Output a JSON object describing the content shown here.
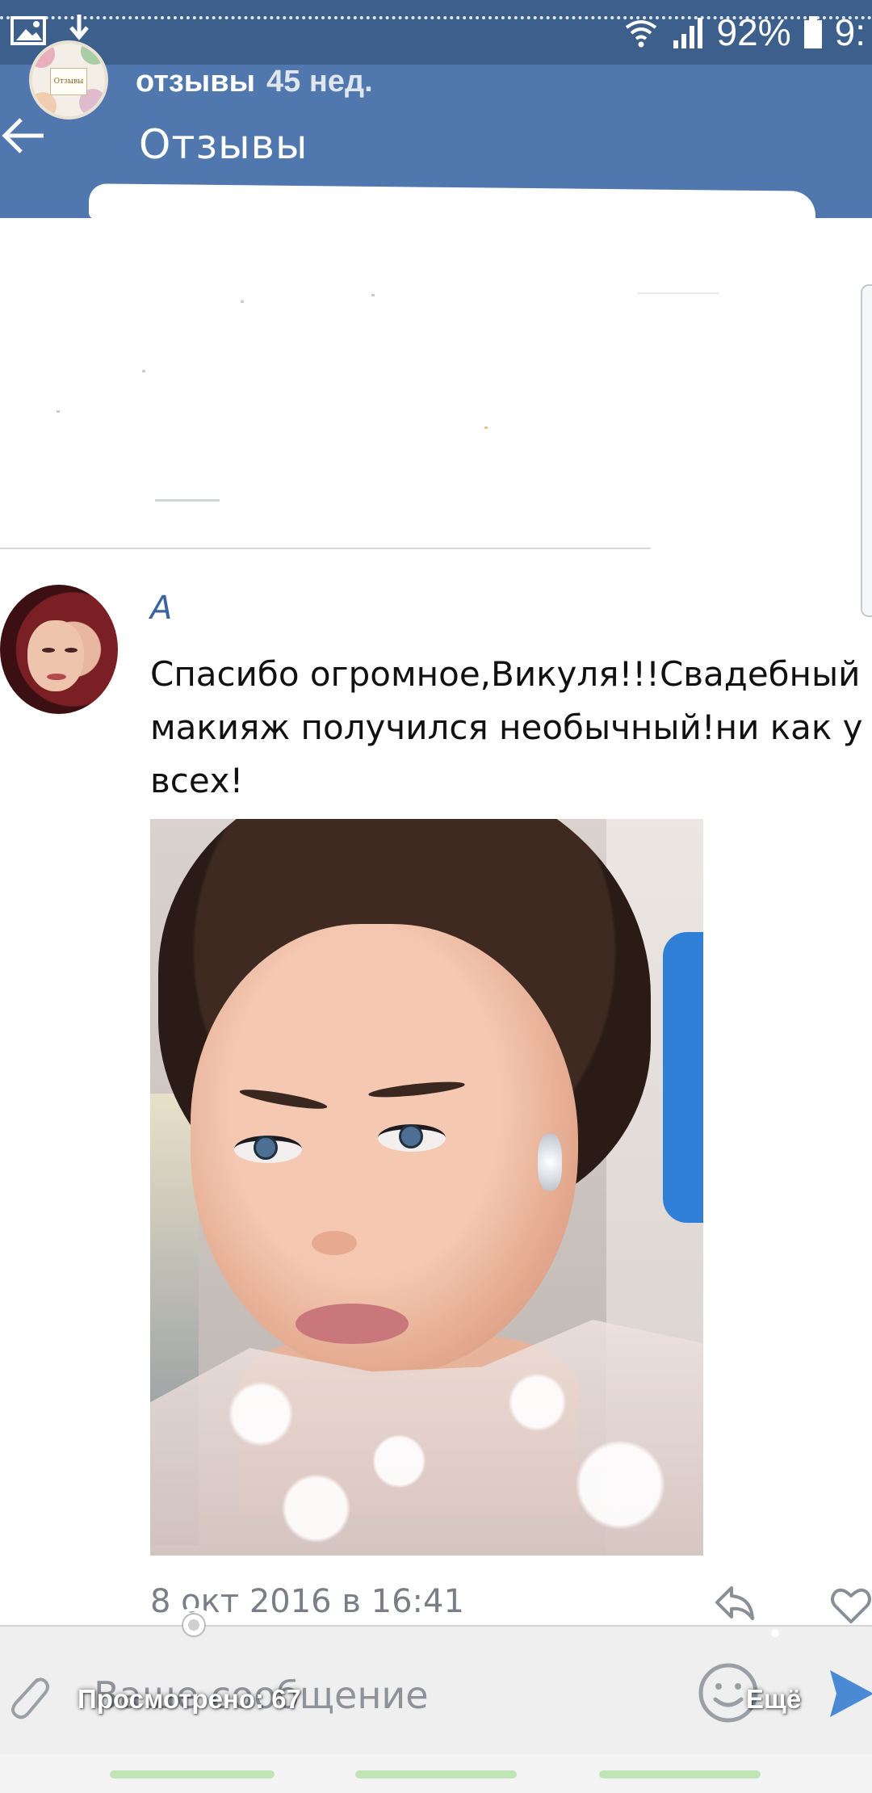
{
  "status_bar": {
    "battery": "92%",
    "clock": "9:"
  },
  "story": {
    "title": "отзывы",
    "age": "45 нед.",
    "avatar_text": "Отзывы"
  },
  "header": {
    "page_title": "Отзывы"
  },
  "comment": {
    "author_fragment": "А",
    "text": "Спасибо огромное,Викуля!!!Свадебный макияж получился необычный!ни как у всех!",
    "date": "8 окт 2016 в 16:41"
  },
  "composer": {
    "placeholder": "Ваше сообщение"
  },
  "overlay": {
    "views": "Просмотрено: 67",
    "more": "Ещё"
  },
  "colors": {
    "status_bar": "#3d5f8c",
    "header": "#5077ae",
    "link": "#3a64a0",
    "progress": "#bfe5b4"
  },
  "icons": [
    "image-icon",
    "download-icon",
    "wifi-icon",
    "signal-icon",
    "battery-icon",
    "back-arrow-icon",
    "reply-icon",
    "heart-icon",
    "attach-icon",
    "emoji-icon",
    "send-icon",
    "eye-icon",
    "more-dots-icon"
  ]
}
